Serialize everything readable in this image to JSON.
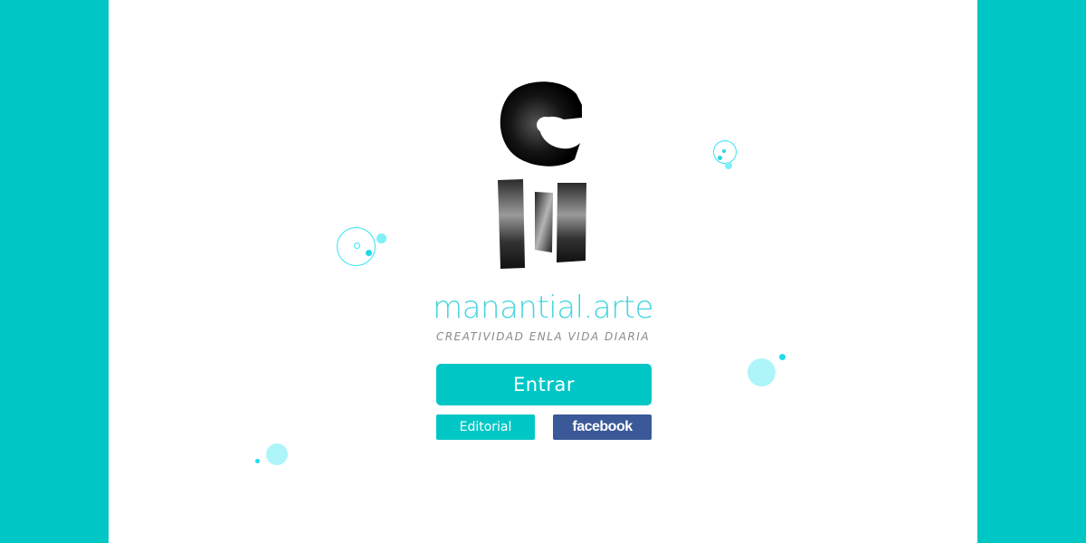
{
  "brand": {
    "name": "manantial.arte",
    "tagline": "CREATIVIDAD ENLA VIDA DIARIA"
  },
  "buttons": {
    "enter": "Entrar",
    "editorial": "Editorial",
    "facebook": "facebook"
  },
  "colors": {
    "background": "#00c7c5",
    "panel": "#ffffff",
    "accent": "#00c7c5",
    "brand_text": "#44d5df",
    "tagline_text": "#8a8a8a",
    "facebook": "#3b5998"
  },
  "icons": {
    "logo": "brush-stroke-logo-icon",
    "decorations": "bubble-icon"
  }
}
